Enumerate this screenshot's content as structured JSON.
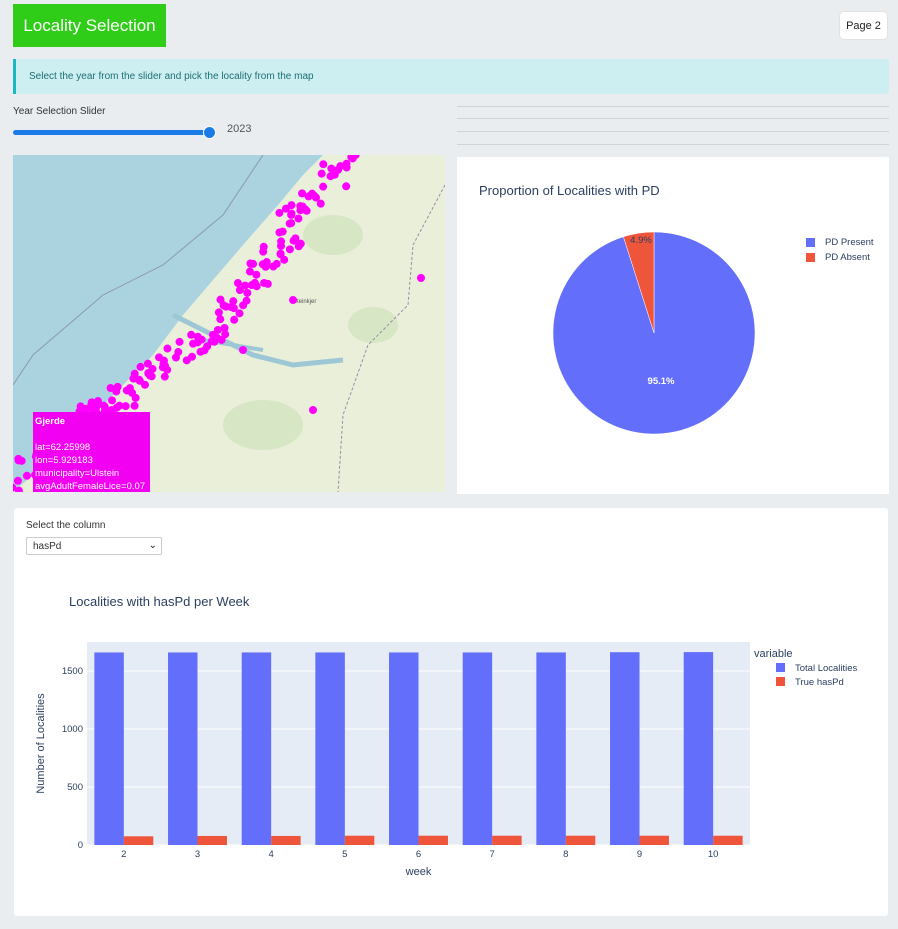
{
  "header": {
    "title": "Locality Selection",
    "page_button": "Page 2"
  },
  "info_text": "Select the year from the slider and pick the locality from the map",
  "slider": {
    "label": "Year Selection Slider",
    "value": "2023",
    "fraction": 1.0
  },
  "map": {
    "tooltip": {
      "name": "Gjerde",
      "lat": "lat=62.25998",
      "lon": "lon=5.929183",
      "municipality": "municipality=Ulstein",
      "lice": "avgAdultFemaleLice=0.07"
    },
    "place_labels": [
      "Steinkjer"
    ],
    "marker_color": "#ff00ff"
  },
  "pie": {
    "title": "Proportion of Localities with PD",
    "legend": [
      {
        "label": "PD Present",
        "color": "#636efa"
      },
      {
        "label": "PD Absent",
        "color": "#ef553b"
      }
    ]
  },
  "bar_section": {
    "select_label": "Select the column",
    "select_value": "hasPd",
    "title": "Localities with hasPd per Week",
    "legend_title": "variable"
  },
  "chart_data": [
    {
      "type": "pie",
      "title": "Proportion of Localities with PD",
      "labels": [
        "PD Present",
        "PD Absent"
      ],
      "values": [
        95.1,
        4.9
      ],
      "value_labels": [
        "95.1%",
        "4.9%"
      ],
      "colors": [
        "#636efa",
        "#ef553b"
      ],
      "legend": "right"
    },
    {
      "type": "bar",
      "title": "Localities with hasPd per Week",
      "xlabel": "week",
      "ylabel": "Number of Localities",
      "categories": [
        "2",
        "3",
        "4",
        "5",
        "6",
        "7",
        "8",
        "9",
        "10"
      ],
      "series": [
        {
          "name": "Total Localities",
          "color": "#636efa",
          "values": [
            1660,
            1660,
            1660,
            1660,
            1660,
            1660,
            1660,
            1662,
            1663
          ]
        },
        {
          "name": "True hasPd",
          "color": "#ef553b",
          "values": [
            75,
            78,
            78,
            80,
            80,
            80,
            80,
            80,
            80
          ]
        }
      ],
      "ylim": [
        0,
        1750
      ],
      "yticks": [
        0,
        500,
        1000,
        1500
      ],
      "grid": true,
      "legend": "right"
    }
  ]
}
